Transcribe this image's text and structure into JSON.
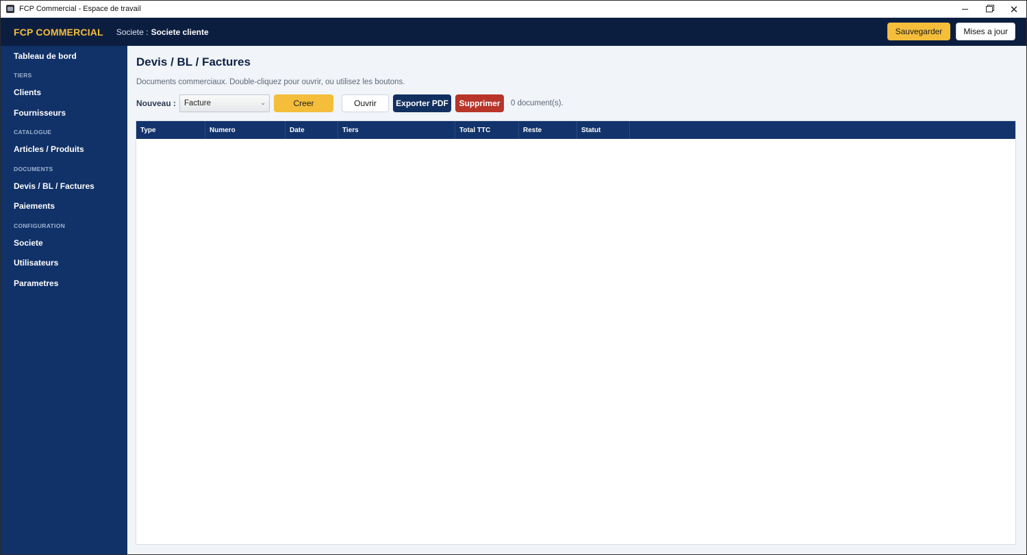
{
  "window": {
    "title": "FCP Commercial - Espace de travail",
    "controls": {
      "minimize": "",
      "maximize": "",
      "close": "✕"
    }
  },
  "header": {
    "brand": "FCP COMMERCIAL",
    "company_label": "Societe :",
    "company_name": "Societe cliente",
    "save_label": "Sauvegarder",
    "updates_label": "Mises a jour"
  },
  "sidebar": {
    "items": [
      {
        "type": "item",
        "label": "Tableau de bord"
      },
      {
        "type": "section",
        "label": "TIERS"
      },
      {
        "type": "item",
        "label": "Clients"
      },
      {
        "type": "item",
        "label": "Fournisseurs"
      },
      {
        "type": "section",
        "label": "CATALOGUE"
      },
      {
        "type": "item",
        "label": "Articles / Produits"
      },
      {
        "type": "section",
        "label": "DOCUMENTS"
      },
      {
        "type": "item",
        "label": "Devis / BL / Factures"
      },
      {
        "type": "item",
        "label": "Paiements"
      },
      {
        "type": "section",
        "label": "CONFIGURATION"
      },
      {
        "type": "item",
        "label": "Societe"
      },
      {
        "type": "item",
        "label": "Utilisateurs"
      },
      {
        "type": "item",
        "label": "Parametres"
      }
    ]
  },
  "main": {
    "title": "Devis / BL / Factures",
    "description": "Documents commerciaux. Double-cliquez pour ouvrir, ou utilisez les boutons.",
    "toolbar": {
      "new_label": "Nouveau :",
      "doc_type_selected": "Facture",
      "create_label": "Creer",
      "open_label": "Ouvrir",
      "export_label": "Exporter PDF",
      "delete_label": "Supprimer",
      "count_text": "0 document(s)."
    },
    "table": {
      "columns": [
        "Type",
        "Numero",
        "Date",
        "Tiers",
        "Total TTC",
        "Reste",
        "Statut"
      ],
      "rows": []
    }
  },
  "icons": {
    "app": "app-window-icon",
    "dropdown": "chevron-down-icon"
  }
}
